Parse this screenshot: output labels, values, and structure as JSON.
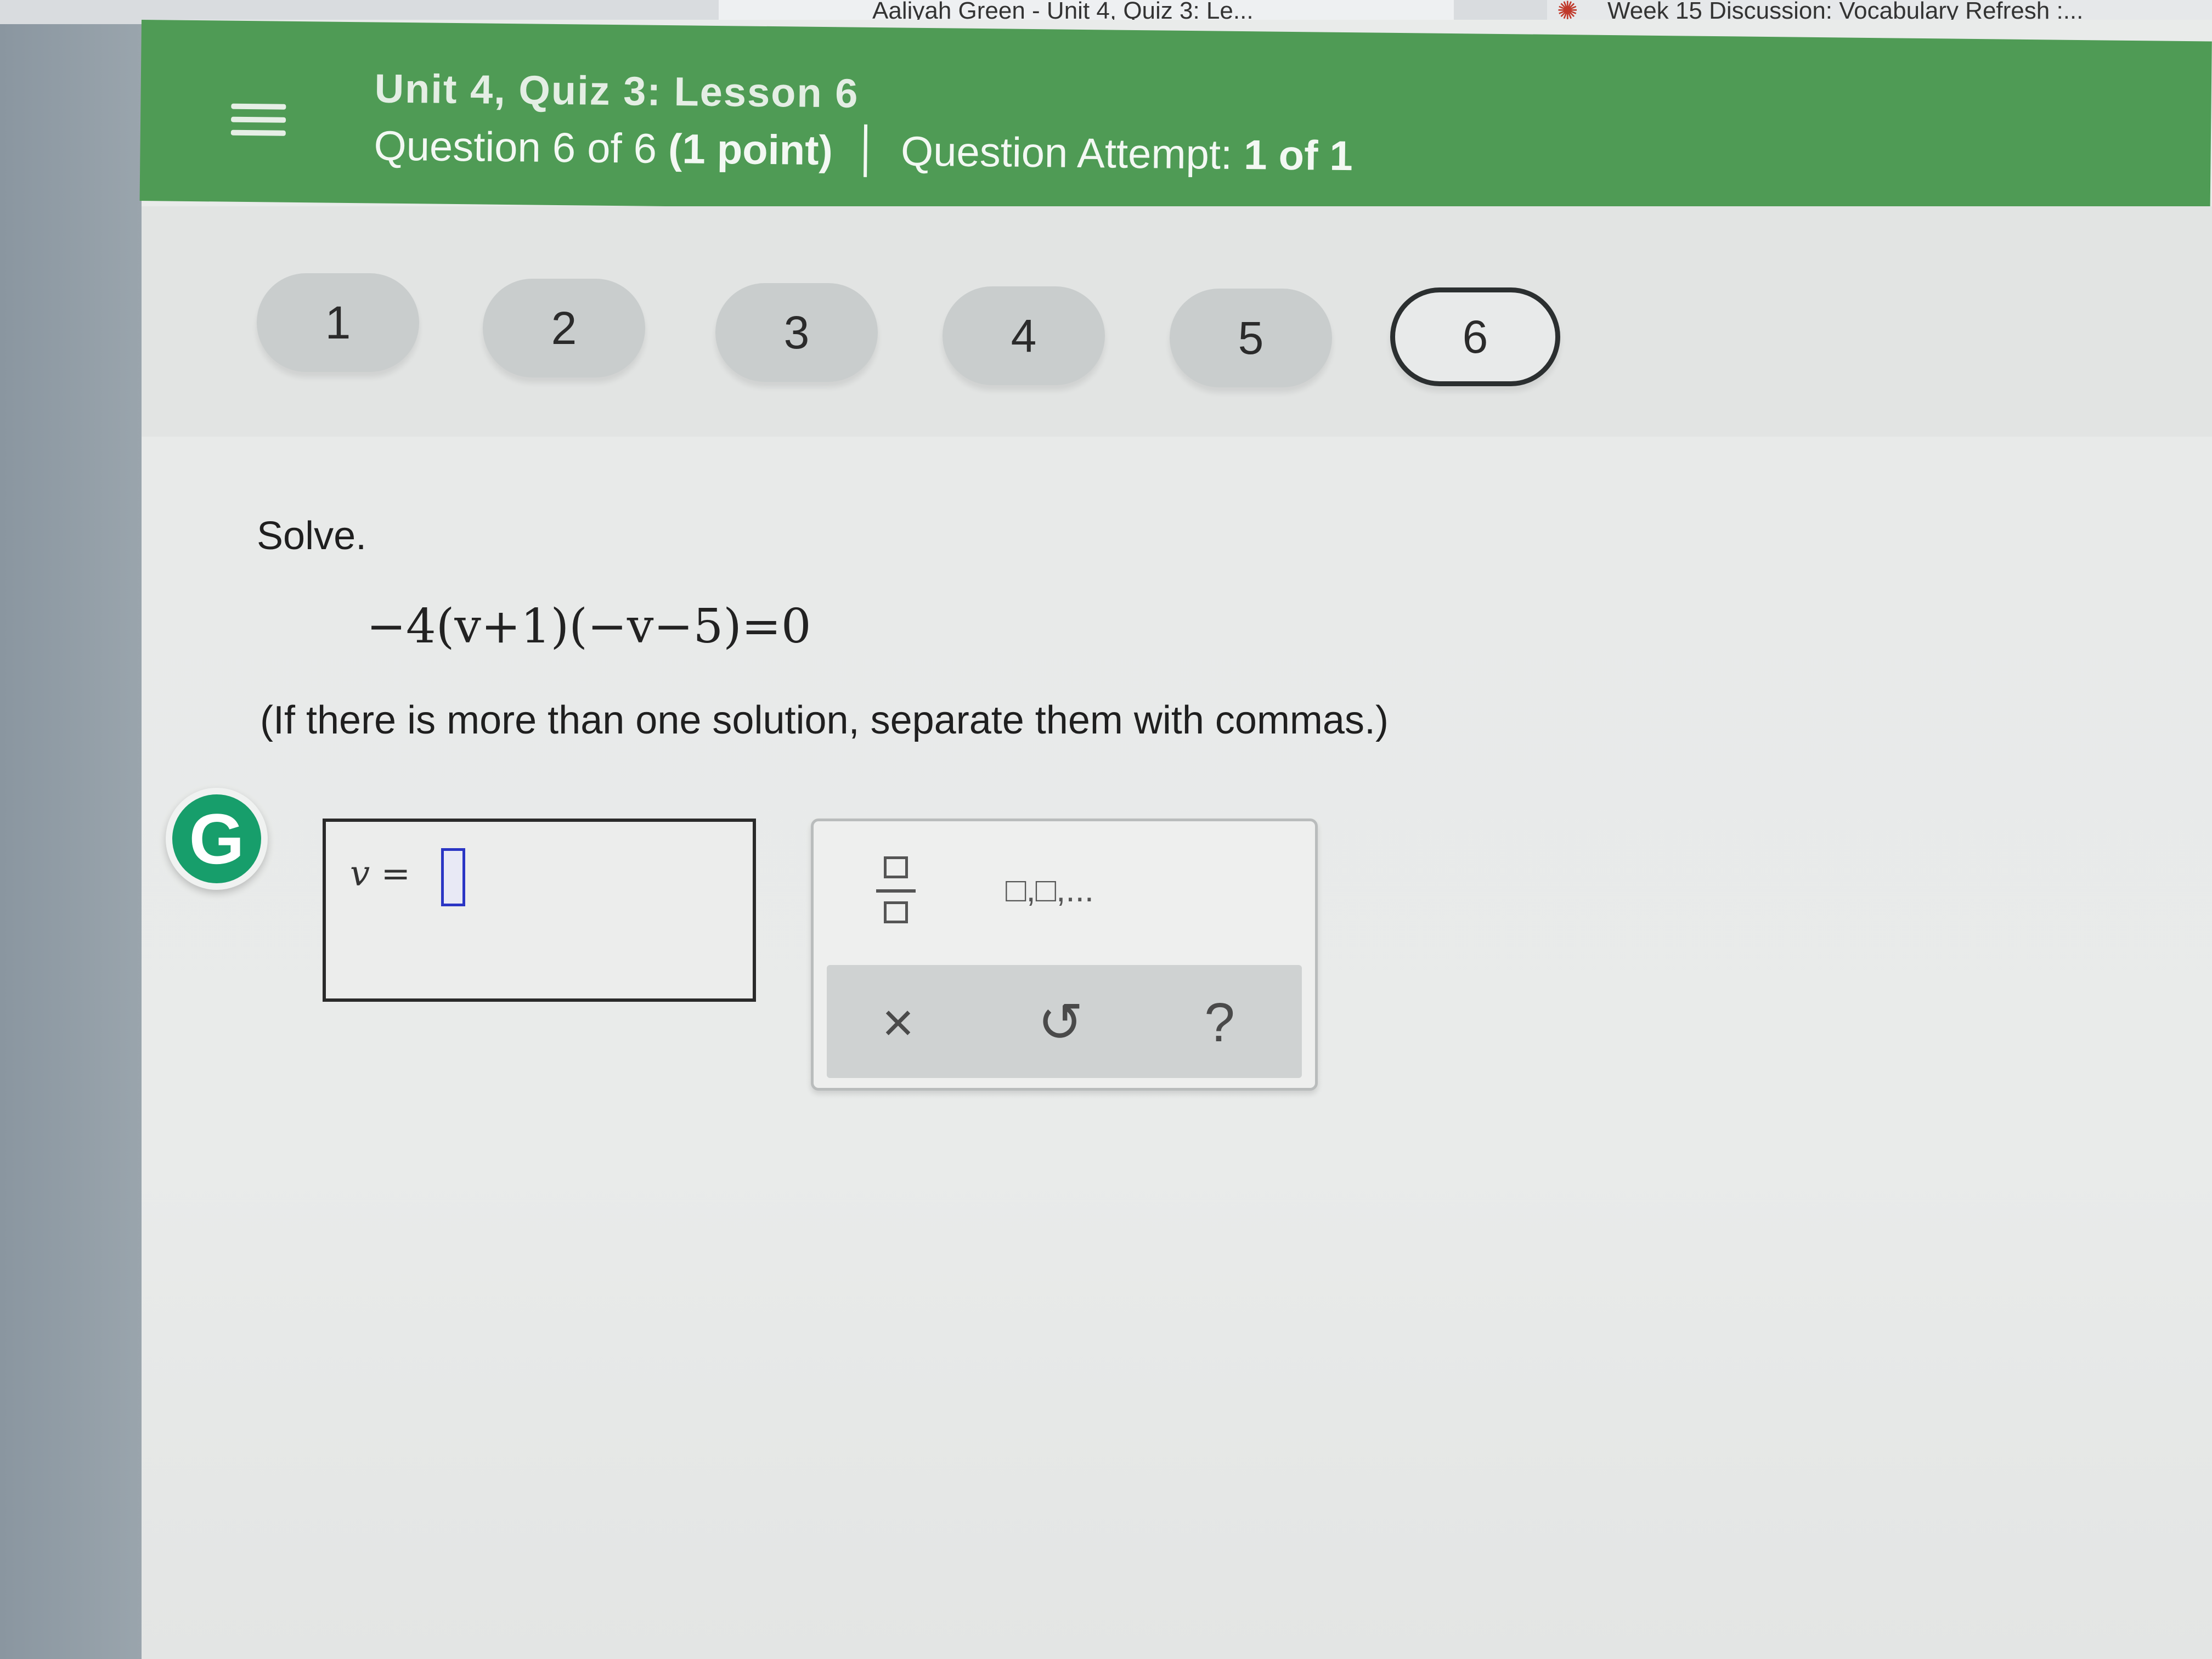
{
  "browser": {
    "tabs": [
      {
        "label": "Aaliyah Green - Unit 4, Quiz 3: Le...",
        "active": true
      },
      {
        "label": "Week 15 Discussion: Vocabulary Refresh :...",
        "active": false
      }
    ]
  },
  "header": {
    "quiz_title": "Unit 4, Quiz 3: Lesson 6",
    "question_prefix": "Question 6 of 6",
    "question_points": "(1 point)",
    "attempt_prefix": "Question Attempt:",
    "attempt_value": "1 of 1",
    "accent_color": "#4f9b55"
  },
  "question_nav": {
    "items": [
      "1",
      "2",
      "3",
      "4",
      "5",
      "6"
    ],
    "active": "6"
  },
  "question": {
    "prompt": "Solve.",
    "equation": "−4(v+1)(−v−5)=0",
    "instruction": "(If there is more than one solution, separate them with commas.)"
  },
  "answer": {
    "label": "v =",
    "value": ""
  },
  "tools": {
    "fraction_icon": "fraction-icon",
    "list_label": "□,□,...",
    "clear_label": "×",
    "undo_label": "↺",
    "help_label": "?"
  },
  "grammarly": {
    "letter": "G",
    "color": "#179e6b"
  }
}
